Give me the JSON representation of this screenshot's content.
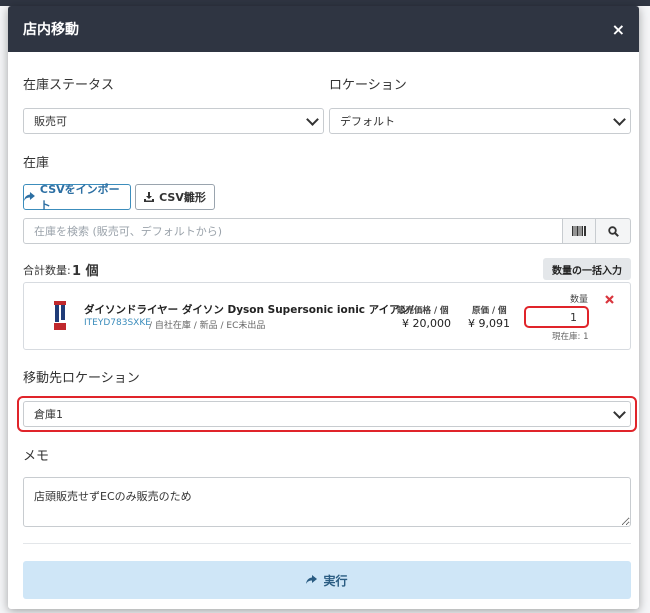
{
  "header": {
    "title": "店内移動",
    "close_label": "×"
  },
  "form": {
    "stock_status_label": "在庫ステータス",
    "stock_status_value": "販売可",
    "location_label": "ロケーション",
    "location_value": "デフォルト",
    "inventory_label": "在庫",
    "csv_import_label": "CSVをインポート",
    "csv_template_label": "CSV雛形",
    "search_placeholder": "在庫を検索 (販売可、デフォルトから)",
    "total_label": "合計数量:",
    "total_value": "1 個",
    "bulk_qty_label": "数量の一括入力",
    "destination_label": "移動先ロケーション",
    "destination_value": "倉庫1",
    "memo_label": "メモ",
    "memo_value": "店頭販売せずECのみ販売のため",
    "execute_label": "実行"
  },
  "item": {
    "name": "ダイソンドライヤー ダイソン Dyson Supersonic ionic アイアン/フ...",
    "sku": "ITEYD783SXKE",
    "meta": "/ 自社在庫 / 新品 / EC未出品",
    "sale_price_label": "販売価格 / 個",
    "sale_price": "¥ 20,000",
    "cost_label": "原価 / 個",
    "cost": "¥ 9,091",
    "qty_label": "数量",
    "qty_value": "1",
    "current_stock": "現在庫: 1"
  },
  "colors": {
    "header_bg": "#2f3542",
    "accent": "#3c8dbc",
    "highlight": "#e0242a",
    "execute_bg": "#cfe6f7"
  }
}
